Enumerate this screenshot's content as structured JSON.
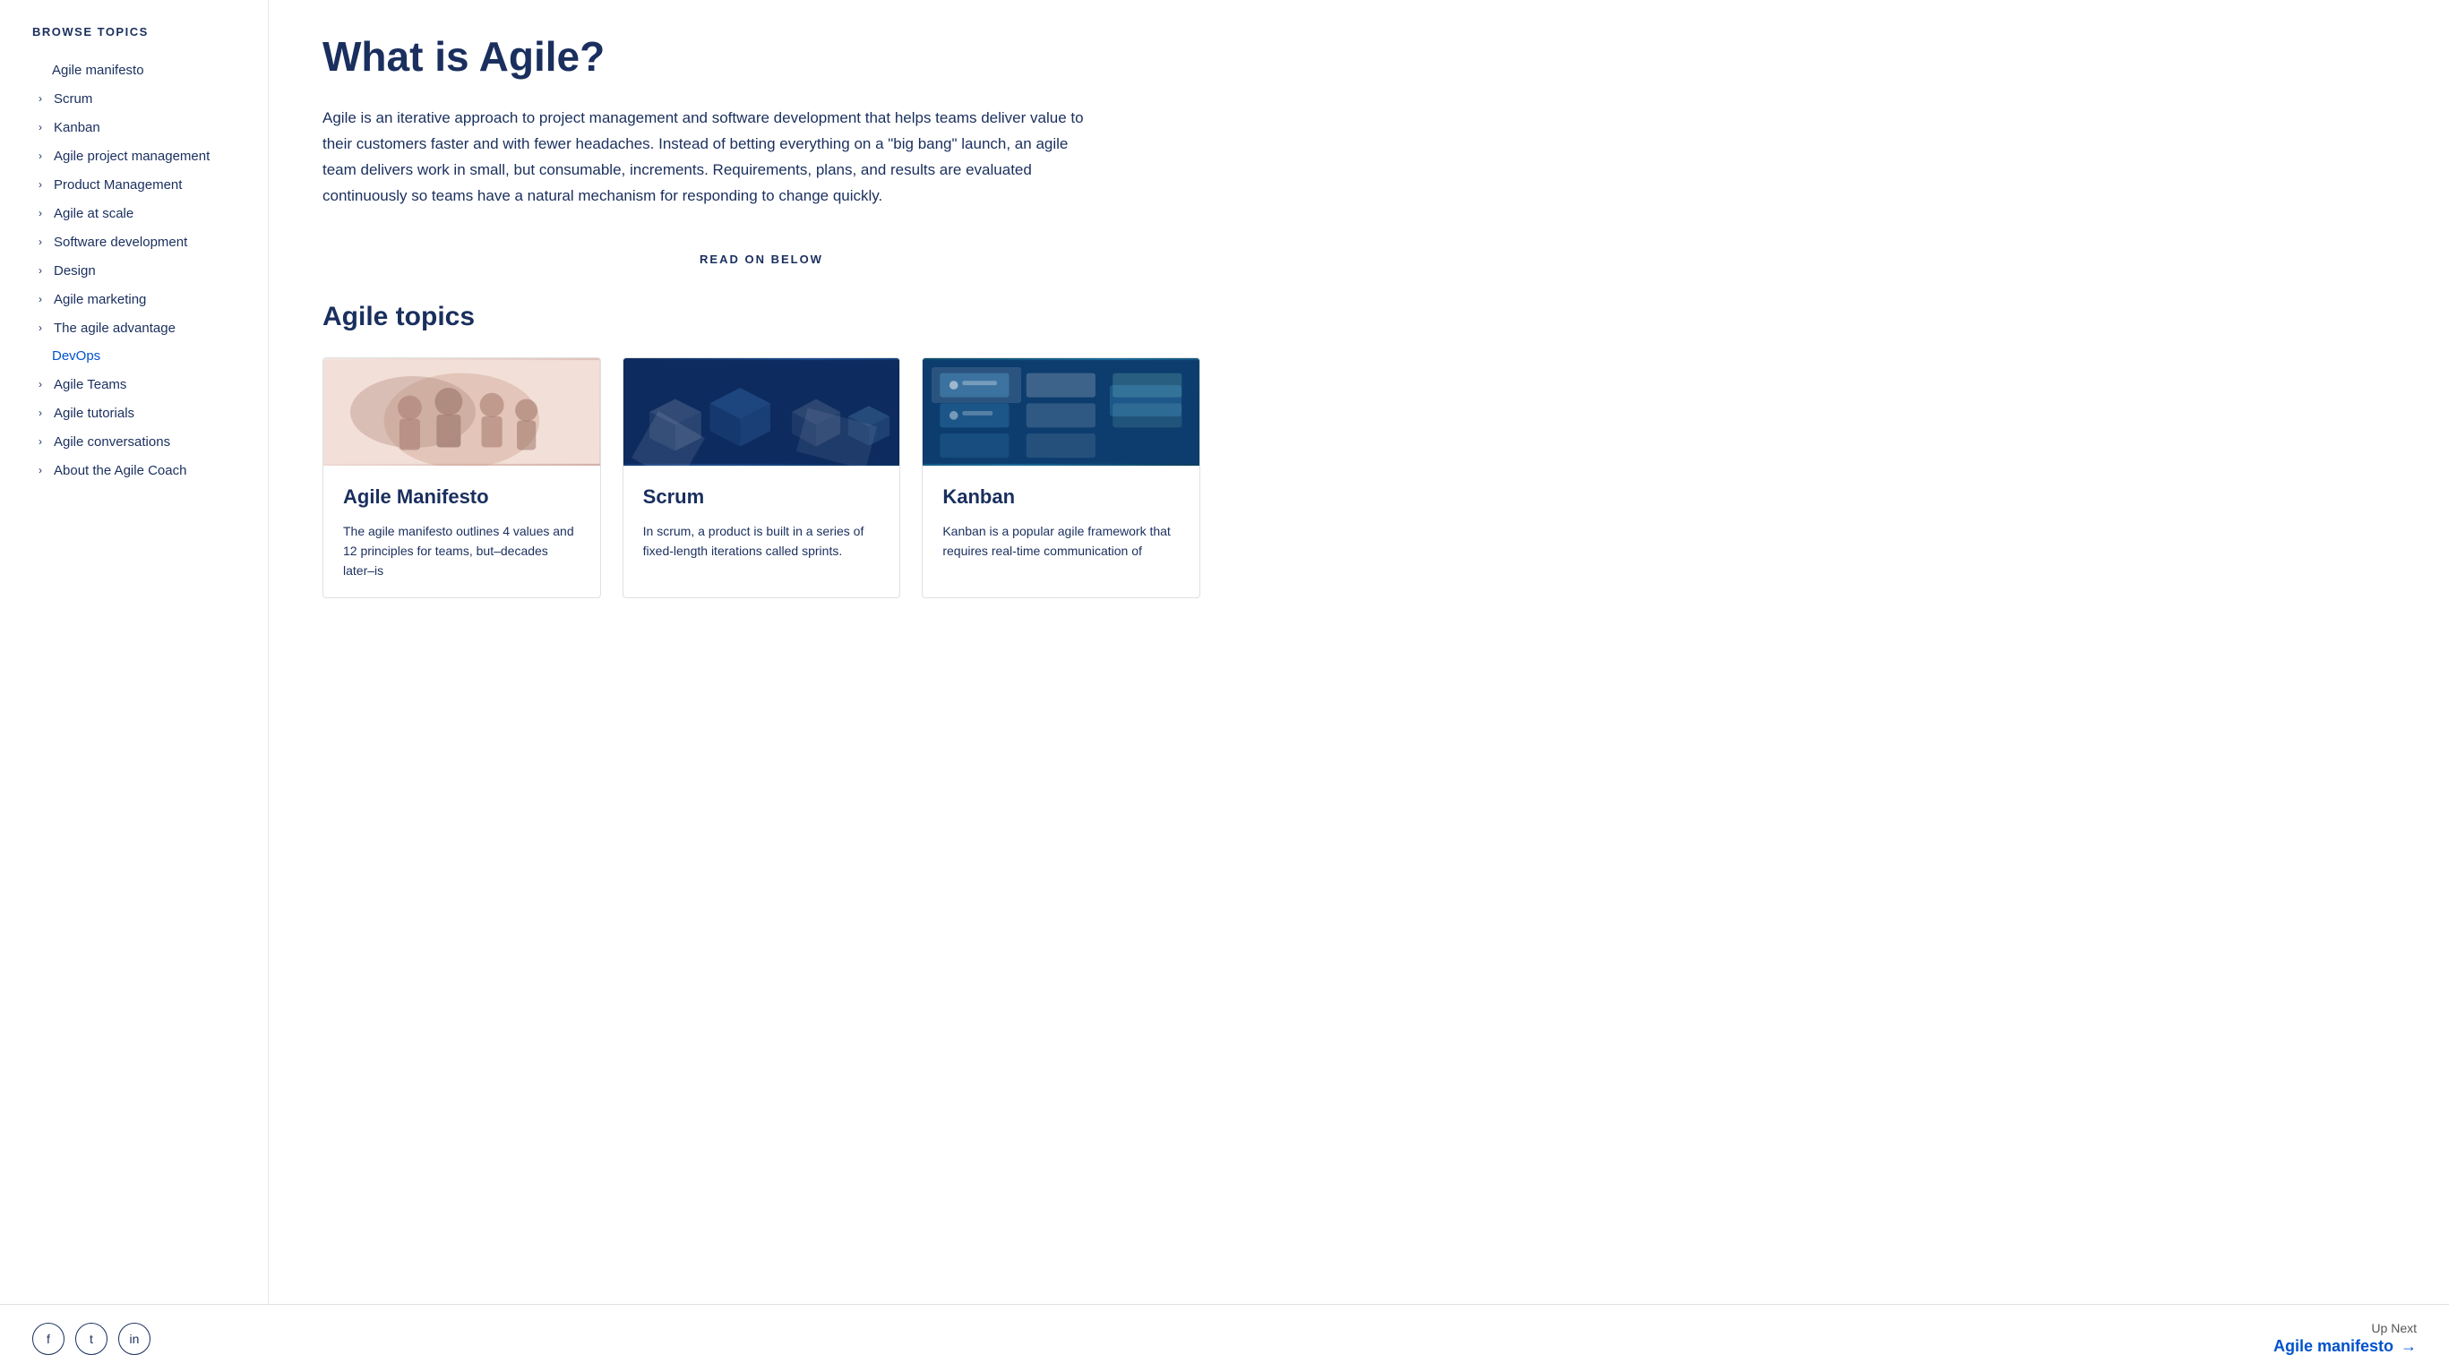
{
  "sidebar": {
    "browse_topics_label": "BROWSE TOPICS",
    "items": [
      {
        "id": "agile-manifesto",
        "label": "Agile manifesto",
        "has_chevron": false
      },
      {
        "id": "scrum",
        "label": "Scrum",
        "has_chevron": true
      },
      {
        "id": "kanban",
        "label": "Kanban",
        "has_chevron": true
      },
      {
        "id": "agile-project-management",
        "label": "Agile project management",
        "has_chevron": true
      },
      {
        "id": "product-management",
        "label": "Product Management",
        "has_chevron": true
      },
      {
        "id": "agile-at-scale",
        "label": "Agile at scale",
        "has_chevron": true
      },
      {
        "id": "software-development",
        "label": "Software development",
        "has_chevron": true
      },
      {
        "id": "design",
        "label": "Design",
        "has_chevron": true
      },
      {
        "id": "agile-marketing",
        "label": "Agile marketing",
        "has_chevron": true
      },
      {
        "id": "the-agile-advantage",
        "label": "The agile advantage",
        "has_chevron": true
      },
      {
        "id": "devops",
        "label": "DevOps",
        "has_chevron": false,
        "special": "devops"
      },
      {
        "id": "agile-teams",
        "label": "Agile Teams",
        "has_chevron": true
      },
      {
        "id": "agile-tutorials",
        "label": "Agile tutorials",
        "has_chevron": true
      },
      {
        "id": "agile-conversations",
        "label": "Agile conversations",
        "has_chevron": true
      },
      {
        "id": "about-the-agile-coach",
        "label": "About the Agile Coach",
        "has_chevron": true
      }
    ]
  },
  "main": {
    "page_title": "What is Agile?",
    "description": "Agile is an iterative approach to project management and software development that helps teams deliver value to their customers faster and with fewer headaches. Instead of betting everything on a \"big bang\" launch, an agile team delivers work in small, but consumable, increments. Requirements, plans, and results are evaluated continuously so teams have a natural mechanism for responding to change quickly.",
    "read_on_below": "READ ON BELOW",
    "agile_topics_title": "Agile topics",
    "cards": [
      {
        "id": "agile-manifesto-card",
        "image_type": "manifesto",
        "title": "Agile Manifesto",
        "text": "The agile manifesto outlines 4 values and 12 principles for teams, but–decades later–is"
      },
      {
        "id": "scrum-card",
        "image_type": "scrum",
        "title": "Scrum",
        "text": "In scrum, a product is built in a series of fixed-length iterations called sprints."
      },
      {
        "id": "kanban-card",
        "image_type": "kanban",
        "title": "Kanban",
        "text": "Kanban is a popular agile framework that requires real-time communication of"
      }
    ]
  },
  "footer": {
    "social_icons": [
      {
        "id": "facebook",
        "label": "f"
      },
      {
        "id": "twitter",
        "label": "t"
      },
      {
        "id": "linkedin",
        "label": "in"
      }
    ],
    "up_next_label": "Up Next",
    "up_next_text": "Agile manifesto",
    "up_next_arrow": "→"
  }
}
